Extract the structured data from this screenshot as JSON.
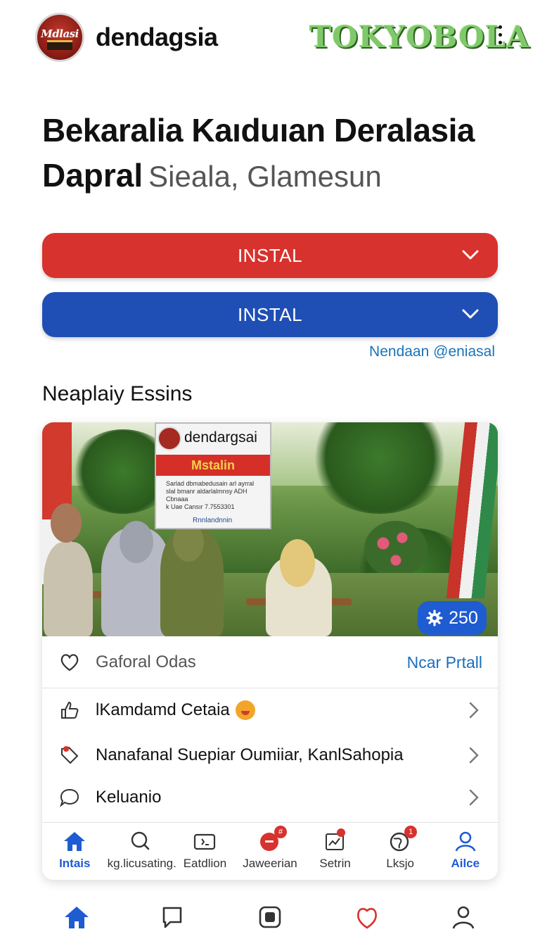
{
  "header": {
    "app_name": "dendagsia",
    "logo_text": "Mdlasi",
    "brand": "TOKYOBOLA"
  },
  "hero": {
    "title_line1": "Bekaralia Kaıduıan Deralasia",
    "title_bold": "Dapral",
    "title_sub": "Sieala, Glamesun"
  },
  "buttons": {
    "primary_label": "INSTAL",
    "secondary_label": "INSTAL"
  },
  "link": "Nendaan @eniasal",
  "section_title": "Neaplaiy Essins",
  "photo": {
    "sign_name": "dendargsai",
    "sign_band": "Mstalin",
    "sign_text": "Sarlad dbmabedusain arl ayrral slal bmanr aldarlalmnsy ADH Cbnaaa",
    "sign_line": "k Uae Cansır   7.7553301",
    "sign_footer": "Rnnlandnnin",
    "count": "250"
  },
  "card": {
    "fav_label": "Gaforal Odas",
    "fav_link": "Ncar Prtall",
    "rows": [
      {
        "label": "lKamdamd Cetaia",
        "icon": "thumbs-up-icon"
      },
      {
        "label": "Nanafanal Suepiar Oumiiar, KanlSahopia",
        "icon": "tag-icon"
      },
      {
        "label": "Keluanio",
        "icon": "chat-bubble-icon"
      }
    ]
  },
  "tabs": [
    {
      "label": "Intais",
      "icon": "home-icon",
      "active": true
    },
    {
      "label": "kg.licusating.",
      "icon": "search-icon"
    },
    {
      "label": "Eatdlion",
      "icon": "wallet-icon"
    },
    {
      "label": "Jaweerian",
      "icon": "notification-icon",
      "badge": "#"
    },
    {
      "label": "Setrin",
      "icon": "chart-icon",
      "badge": ""
    },
    {
      "label": "Lksjo",
      "icon": "globe-icon",
      "badge": "1"
    },
    {
      "label": "Ailce",
      "icon": "profile-icon",
      "active": true
    }
  ],
  "colors": {
    "red": "#d7322d",
    "blue": "#1f4fb5",
    "link": "#1a73b8",
    "brand_green": "#7fc96a"
  }
}
